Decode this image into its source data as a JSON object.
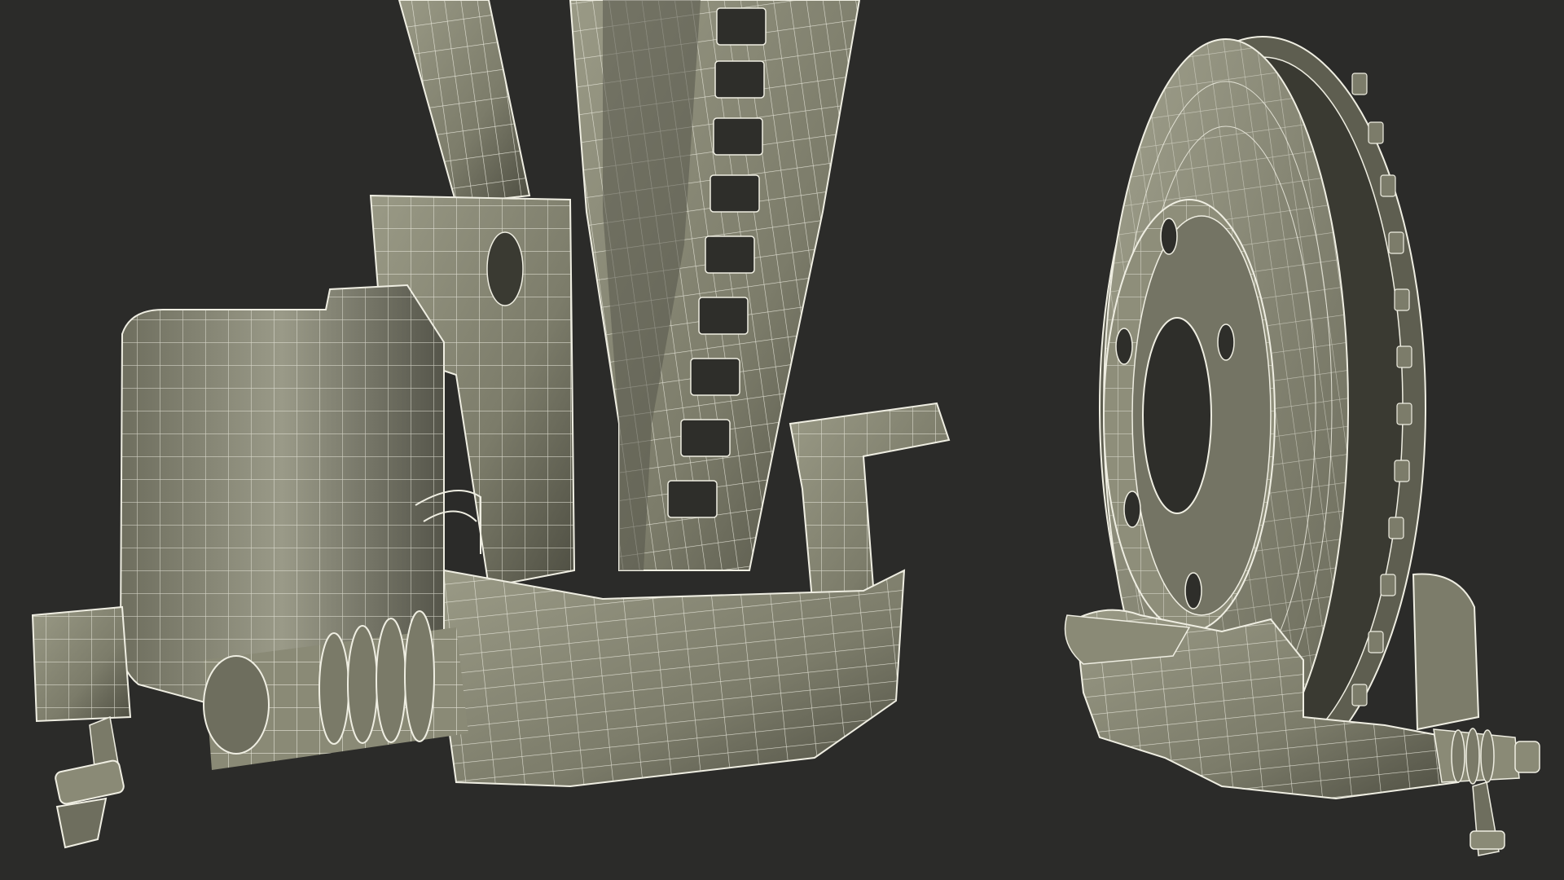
{
  "scene": {
    "background_color": "#2b2b29",
    "model_surface_color": "#8b8b78",
    "model_shadow_color": "#4a4a3e",
    "wireframe_color": "#efeee2",
    "objects": [
      {
        "name": "brake-caliper-closeup",
        "description_icon": "caliper-icon"
      },
      {
        "name": "brake-disc-assembly",
        "description_icon": "disc-icon"
      }
    ]
  }
}
